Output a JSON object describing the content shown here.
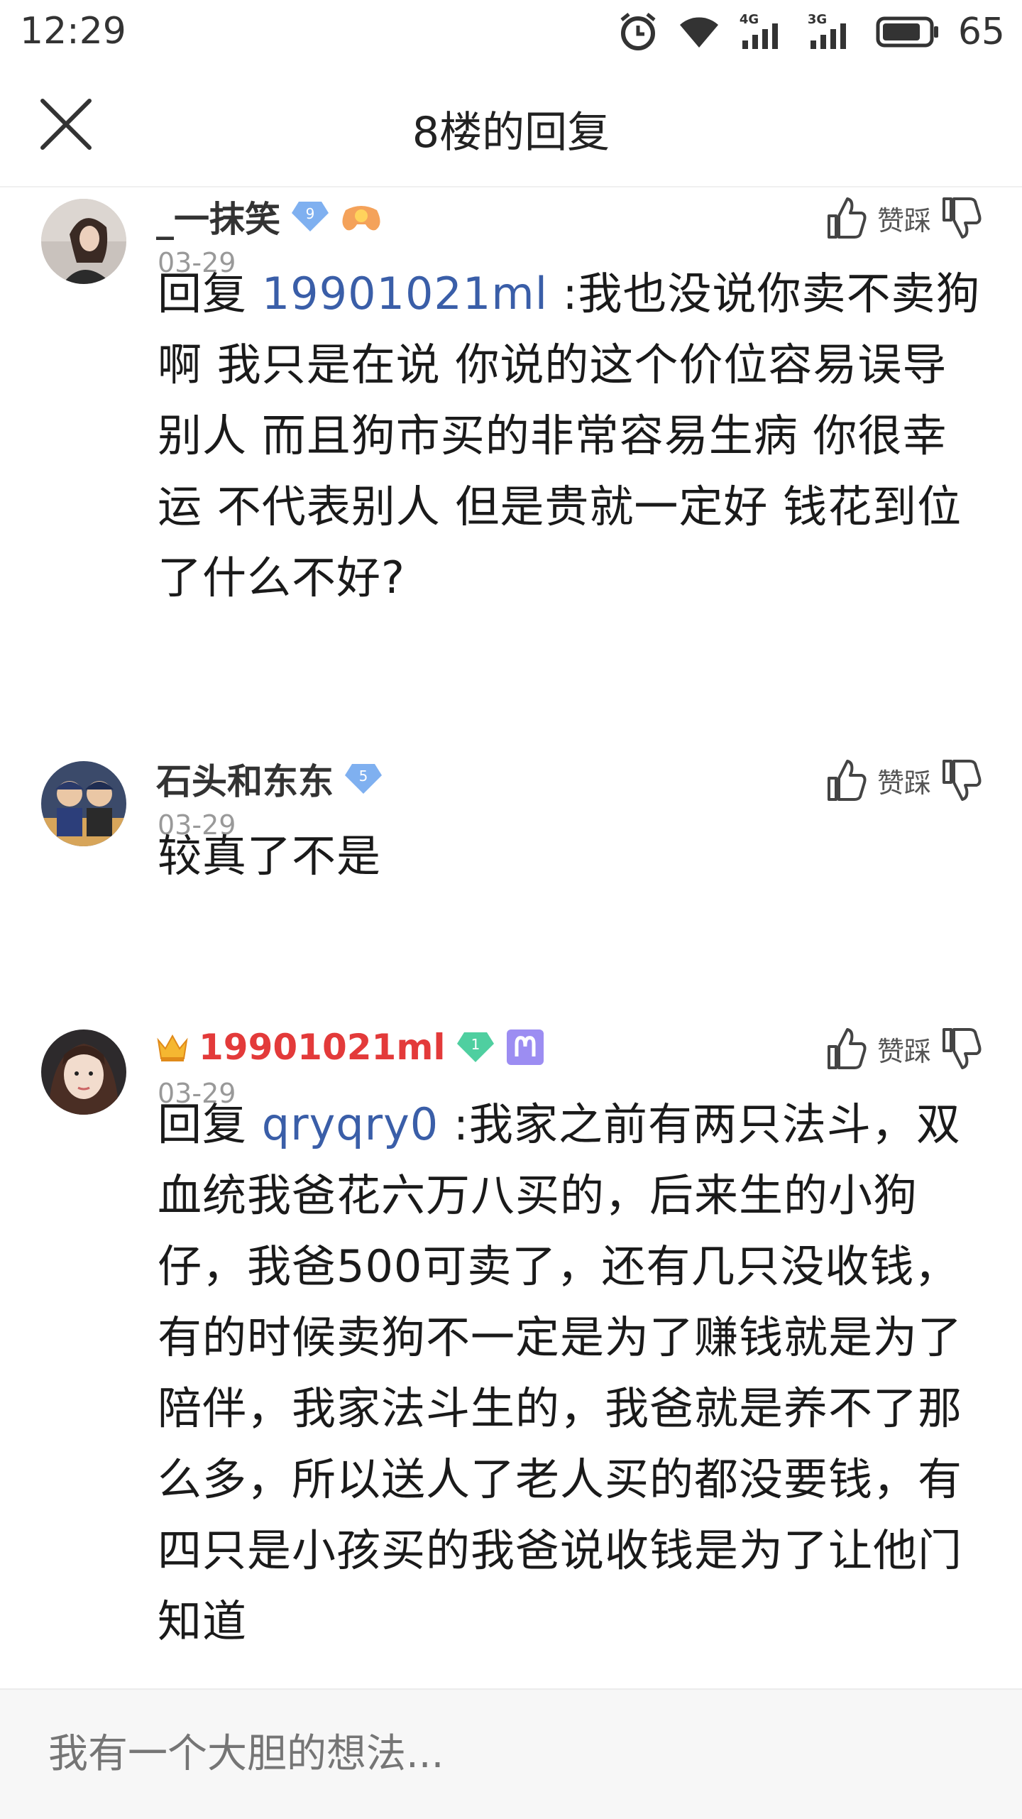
{
  "status_bar": {
    "time": "12:29",
    "net1": "4G",
    "net2": "3G",
    "battery": "65"
  },
  "header": {
    "title": "8楼的回复"
  },
  "action_labels": {
    "like_dislike": "赞踩"
  },
  "posts": [
    {
      "username": "_一抹笑",
      "level": "9",
      "date": "03-29",
      "reply_prefix": "回复",
      "mention": "19901021ml",
      "text": ":我也没说你卖不卖狗啊 我只是在说 你说的这个价位容易误导别人 而且狗市买的非常容易生病 你很幸运 不代表别人 但是贵就一定好 钱花到位了什么不好?"
    },
    {
      "username": "石头和东东",
      "level": "5",
      "date": "03-29",
      "text": "较真了不是"
    },
    {
      "username": "19901021ml",
      "level": "1",
      "date": "03-29",
      "reply_prefix": "回复",
      "mention": "qryqry0",
      "text": ":我家之前有两只法斗，双血统我爸花六万八买的，后来生的小狗仔，我爸500可卖了，还有几只没收钱，有的时候卖狗不一定是为了赚钱就是为了陪伴，我家法斗生的，我爸就是养不了那么多，所以送人了老人买的都没要钱，有四只是小孩买的我爸说收钱是为了让他门知道"
    }
  ],
  "reply_bar": {
    "placeholder": "我有一个大胆的想法..."
  },
  "colors": {
    "mention": "#3a5ea8",
    "vip_name": "#e33a3a",
    "date": "#999999",
    "placeholder": "#c2c2c2"
  }
}
